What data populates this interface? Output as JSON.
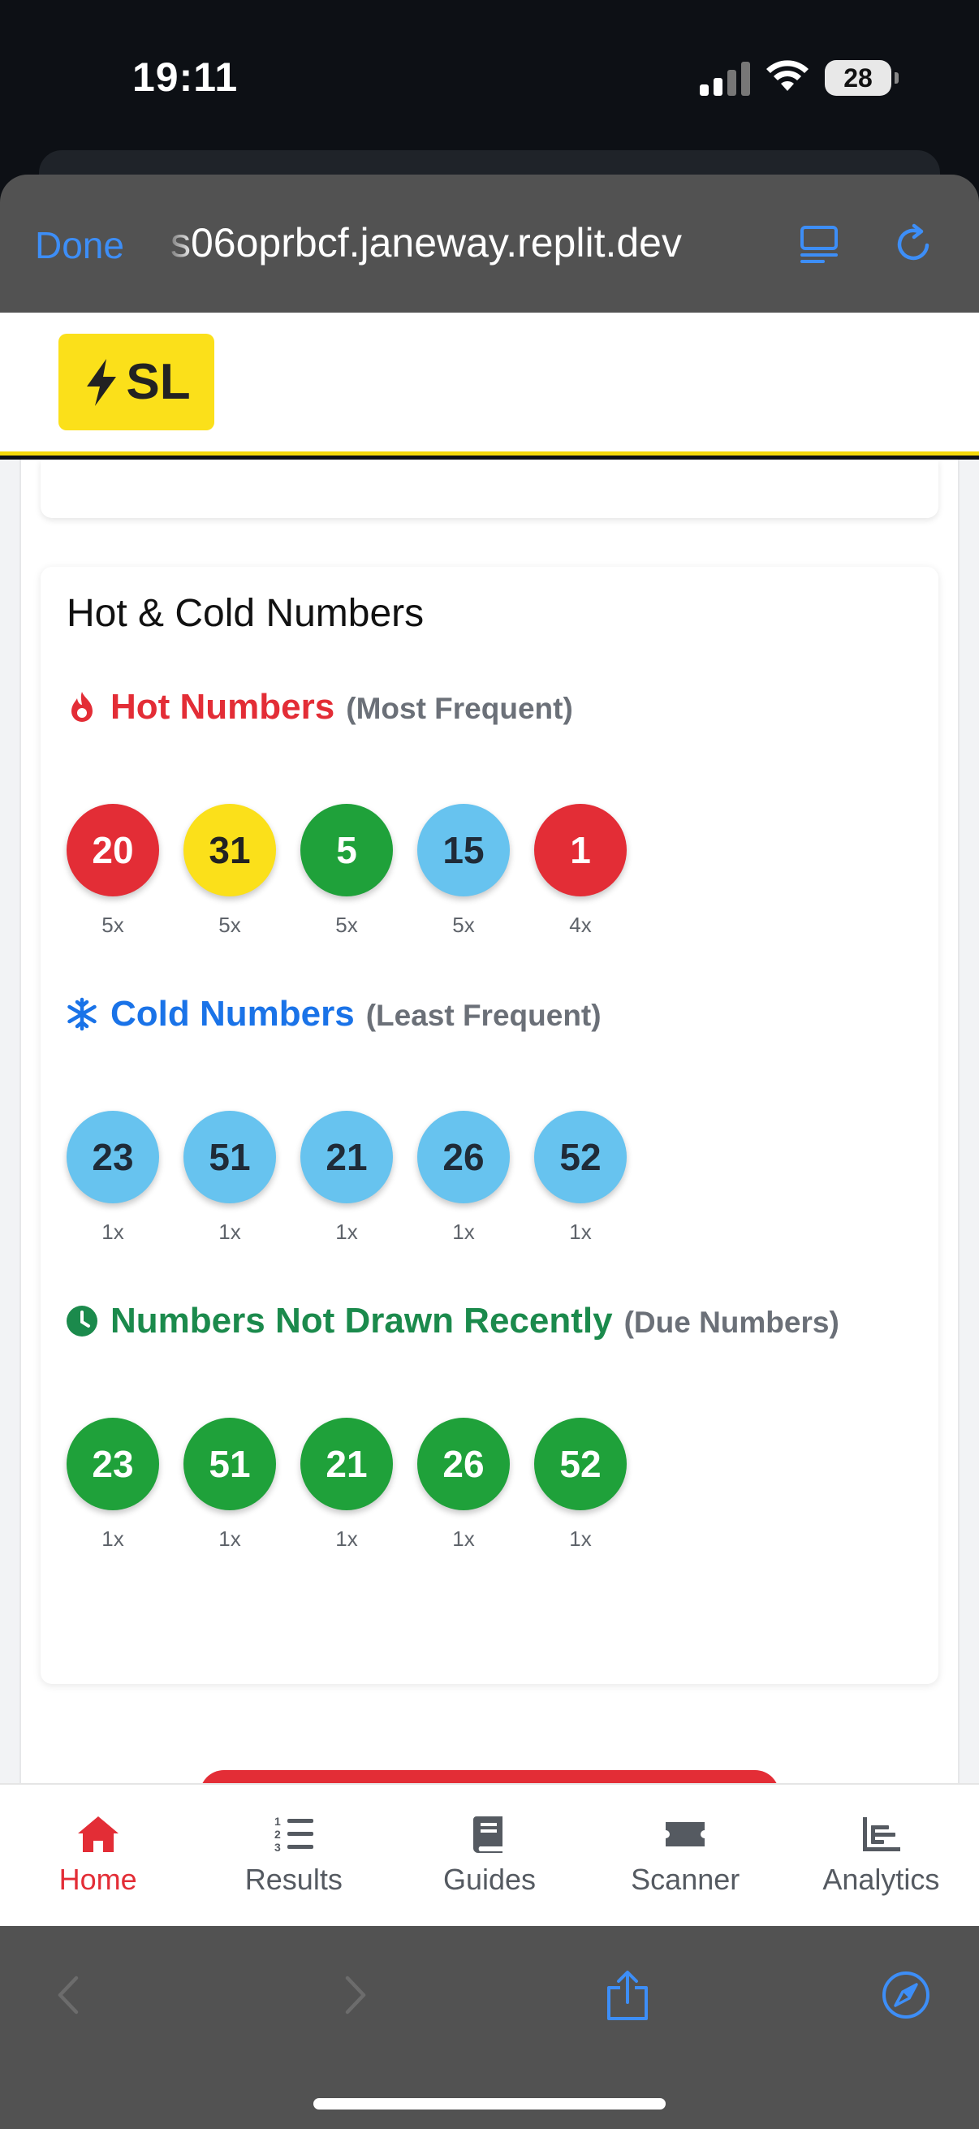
{
  "status_bar": {
    "time": "19:11",
    "battery": "28"
  },
  "browser": {
    "done_label": "Done",
    "url": "s06oprbcf.janeway.replit.dev",
    "accent": "#3d8ef7"
  },
  "app": {
    "logo_text": "SL",
    "brand_color": "#fbe01a"
  },
  "hot_cold": {
    "title": "Hot & Cold Numbers",
    "hot": {
      "title": "Hot Numbers",
      "subtitle": "(Most Frequent)",
      "color": "#e32d36",
      "balls": [
        {
          "number": "20",
          "count": "5x",
          "color": "red"
        },
        {
          "number": "31",
          "count": "5x",
          "color": "yellow"
        },
        {
          "number": "5",
          "count": "5x",
          "color": "green"
        },
        {
          "number": "15",
          "count": "5x",
          "color": "blue"
        },
        {
          "number": "1",
          "count": "4x",
          "color": "red"
        }
      ]
    },
    "cold": {
      "title": "Cold Numbers",
      "subtitle": "(Least Frequent)",
      "color": "#1a73e8",
      "balls": [
        {
          "number": "23",
          "count": "1x",
          "color": "blue"
        },
        {
          "number": "51",
          "count": "1x",
          "color": "blue"
        },
        {
          "number": "21",
          "count": "1x",
          "color": "blue"
        },
        {
          "number": "26",
          "count": "1x",
          "color": "blue"
        },
        {
          "number": "52",
          "count": "1x",
          "color": "blue"
        }
      ]
    },
    "due": {
      "title": "Numbers Not Drawn Recently",
      "subtitle": "(Due Numbers)",
      "color": "#1b8a4c",
      "balls": [
        {
          "number": "23",
          "count": "1x",
          "color": "green"
        },
        {
          "number": "51",
          "count": "1x",
          "color": "green"
        },
        {
          "number": "21",
          "count": "1x",
          "color": "green"
        },
        {
          "number": "26",
          "count": "1x",
          "color": "green"
        },
        {
          "number": "52",
          "count": "1x",
          "color": "green"
        }
      ]
    }
  },
  "tabs": [
    {
      "label": "Home",
      "icon": "home-icon",
      "active": true
    },
    {
      "label": "Results",
      "icon": "ordered-list-icon",
      "active": false
    },
    {
      "label": "Guides",
      "icon": "book-icon",
      "active": false
    },
    {
      "label": "Scanner",
      "icon": "ticket-icon",
      "active": false
    },
    {
      "label": "Analytics",
      "icon": "bar-chart-icon",
      "active": false
    }
  ]
}
